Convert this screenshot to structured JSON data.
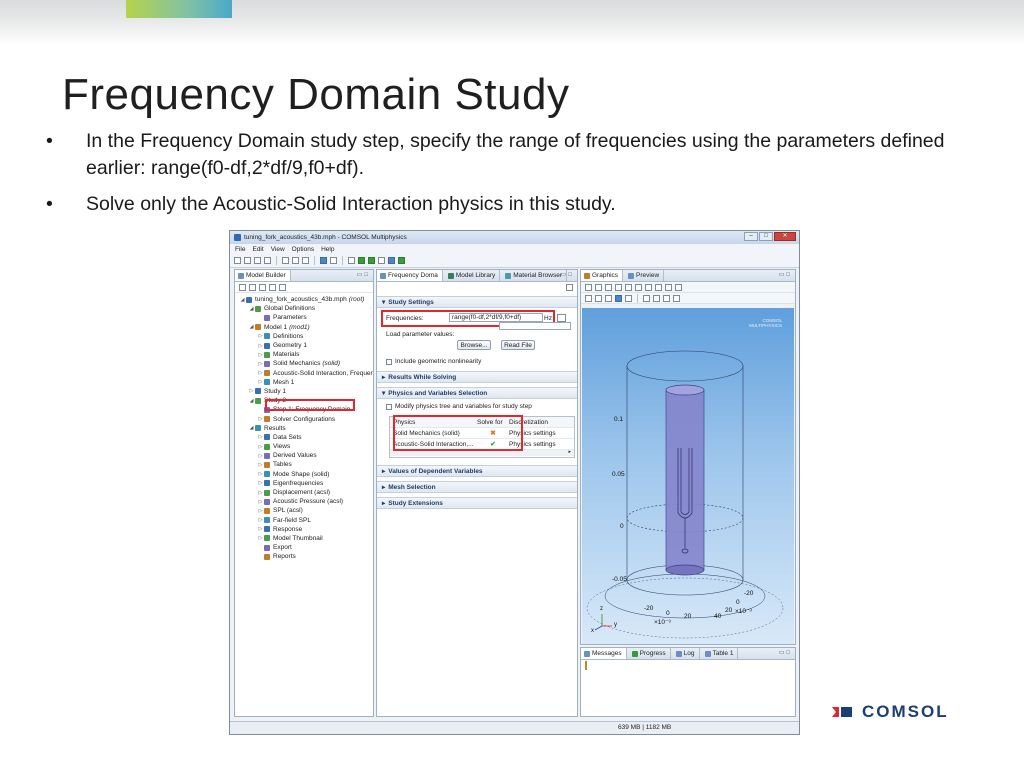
{
  "slide": {
    "title": "Frequency Domain Study",
    "bullets": [
      "In the Frequency Domain study step, specify the range of frequencies using the parameters defined earlier: range(f0-df,2*df/9,f0+df).",
      "Solve only the Acoustic-Solid Interaction physics in this study."
    ],
    "bullet_glyph": "•",
    "logo": {
      "text": "COMSOL",
      "accent_color": "#e0282e",
      "text_color": "#1b3e73"
    }
  },
  "window": {
    "title": "tuning_fork_acoustics_43b.mph - COMSOL Multiphysics",
    "controls": {
      "minimize": "–",
      "maximize": "□",
      "close": "✕"
    },
    "menu": [
      "File",
      "Edit",
      "View",
      "Options",
      "Help"
    ],
    "status": "639 MB | 1182 MB"
  },
  "model_builder": {
    "tab_label": "Model Builder",
    "tree": [
      {
        "label": "tuning_fork_acoustics_43b.mph",
        "suffix": "(root)",
        "indent": 0,
        "arrow": "◢"
      },
      {
        "label": "Global Definitions",
        "indent": 1,
        "arrow": "◢"
      },
      {
        "label": "Parameters",
        "indent": 2,
        "arrow": ""
      },
      {
        "label": "Model 1",
        "suffix": "(mod1)",
        "indent": 1,
        "arrow": "◢"
      },
      {
        "label": "Definitions",
        "indent": 2,
        "arrow": "▷"
      },
      {
        "label": "Geometry 1",
        "indent": 2,
        "arrow": "▷"
      },
      {
        "label": "Materials",
        "indent": 2,
        "arrow": "▷"
      },
      {
        "label": "Solid Mechanics",
        "suffix": "(solid)",
        "indent": 2,
        "arrow": "▷"
      },
      {
        "label": "Acoustic-Solid Interaction, Frequer",
        "indent": 2,
        "arrow": "▷"
      },
      {
        "label": "Mesh 1",
        "indent": 2,
        "arrow": "▷"
      },
      {
        "label": "Study 1",
        "indent": 1,
        "arrow": "▷"
      },
      {
        "label": "Study 2",
        "indent": 1,
        "arrow": "◢"
      },
      {
        "label": "Step 1: Frequency Domain",
        "indent": 2,
        "arrow": ""
      },
      {
        "label": "Solver Configurations",
        "indent": 2,
        "arrow": "▷"
      },
      {
        "label": "Results",
        "indent": 1,
        "arrow": "◢"
      },
      {
        "label": "Data Sets",
        "indent": 2,
        "arrow": "▷"
      },
      {
        "label": "Views",
        "indent": 2,
        "arrow": "▷"
      },
      {
        "label": "Derived Values",
        "indent": 2,
        "arrow": "▷"
      },
      {
        "label": "Tables",
        "indent": 2,
        "arrow": "▷"
      },
      {
        "label": "Mode Shape (solid)",
        "indent": 2,
        "arrow": "▷"
      },
      {
        "label": "Eigenfrequencies",
        "indent": 2,
        "arrow": "▷"
      },
      {
        "label": "Displacement (acsl)",
        "indent": 2,
        "arrow": "▷"
      },
      {
        "label": "Acoustic Pressure (acsl)",
        "indent": 2,
        "arrow": "▷"
      },
      {
        "label": "SPL (acsl)",
        "indent": 2,
        "arrow": "▷"
      },
      {
        "label": "Far-field SPL",
        "indent": 2,
        "arrow": "▷"
      },
      {
        "label": "Response",
        "indent": 2,
        "arrow": "▷"
      },
      {
        "label": "Model Thumbnail",
        "indent": 2,
        "arrow": "▷"
      },
      {
        "label": "Export",
        "indent": 2,
        "arrow": ""
      },
      {
        "label": "Reports",
        "indent": 2,
        "arrow": ""
      }
    ]
  },
  "settings": {
    "tabs": [
      "Frequency Doma",
      "Model Library",
      "Material Browser"
    ],
    "sections": {
      "study_settings": "Study Settings",
      "results_while_solving": "Results While Solving",
      "physics_variables": "Physics and Variables Selection",
      "dependent_values": "Values of Dependent Variables",
      "mesh_selection": "Mesh Selection",
      "study_extensions": "Study Extensions"
    },
    "frequencies_label": "Frequencies:",
    "frequencies_value": "range(f0-df,2*df/9,f0+df)",
    "frequencies_unit": "Hz",
    "load_parameter_label": "Load parameter values:",
    "browse_button": "Browse...",
    "read_file_button": "Read File",
    "include_nonlinearity": "Include geometric nonlinearity",
    "modify_physics": "Modify physics tree and variables for study step",
    "physics_table": {
      "headers": [
        "Physics",
        "Solve for",
        "Discretization"
      ],
      "rows": [
        {
          "physics": "Solid Mechanics (solid)",
          "solve_for": "✖",
          "discretization": "Physics settings"
        },
        {
          "physics": "Acoustic-Solid Interaction,...",
          "solve_for": "✔",
          "discretization": "Physics settings"
        }
      ]
    }
  },
  "graphics": {
    "tabs": [
      "Graphics",
      "Preview"
    ],
    "watermark": "COMSOL MULTIPHYSICS",
    "vertical_ticks": [
      "0.1",
      "0.05",
      "0",
      "-0.05"
    ],
    "bottom_labels": {
      "x_left": "-20",
      "x_zero": "0",
      "x_scale": "×10⁻³",
      "x_right": "20",
      "y_left": "20",
      "y_right": "40",
      "z_top": "-20",
      "z_zero": "0",
      "z_right": "20",
      "z_scale": "×10⁻³"
    },
    "axis_letters": {
      "z": "z",
      "x": "x",
      "y": "y"
    }
  },
  "messages": {
    "tabs": [
      "Messages",
      "Progress",
      "Log",
      "Table 1"
    ]
  }
}
